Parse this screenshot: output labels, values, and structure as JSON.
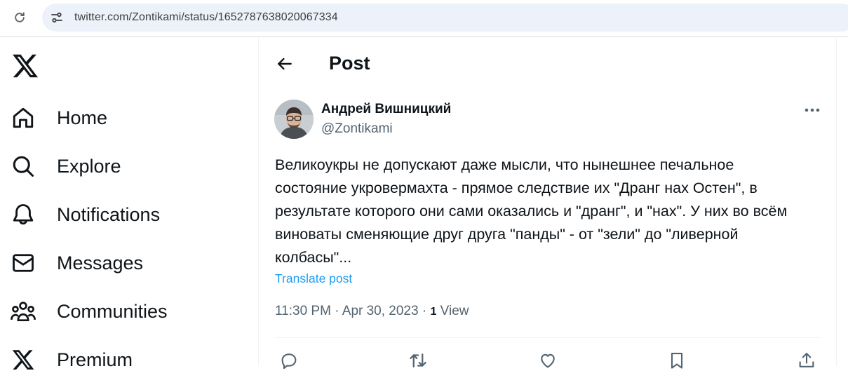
{
  "browser": {
    "url": "twitter.com/Zontikami/status/1652787638020067334"
  },
  "sidebar": {
    "items": [
      {
        "label": "Home",
        "icon": "home-icon"
      },
      {
        "label": "Explore",
        "icon": "search-icon"
      },
      {
        "label": "Notifications",
        "icon": "bell-icon"
      },
      {
        "label": "Messages",
        "icon": "envelope-icon"
      },
      {
        "label": "Communities",
        "icon": "people-icon"
      },
      {
        "label": "Premium",
        "icon": "x-logo-icon"
      }
    ]
  },
  "header": {
    "title": "Post"
  },
  "post": {
    "author_name": "Андрей Вишницкий",
    "author_handle": "@Zontikami",
    "text": "Великоукры не  допускают даже мысли, что нынешнее печальное\nсостояние  укровермахта - прямое следствие их \"Дранг нах Остен\", в\nрезультате которого они сами оказались и \"дранг\", и \"нах\". У них во всём\nвиноваты сменяющие друг друга \"панды\" - от \"зели\" до  \"ливерной\nколбасы\"...",
    "translate_label": "Translate post",
    "time": "11:30 PM",
    "date": "Apr 30, 2023",
    "separator": " · ",
    "views_count": "1",
    "views_label": " View"
  },
  "colors": {
    "text_primary": "#0f1419",
    "text_secondary": "#536471",
    "link": "#1d9bf0",
    "border": "#eff3f4",
    "omnibox": "#edf2fa"
  }
}
